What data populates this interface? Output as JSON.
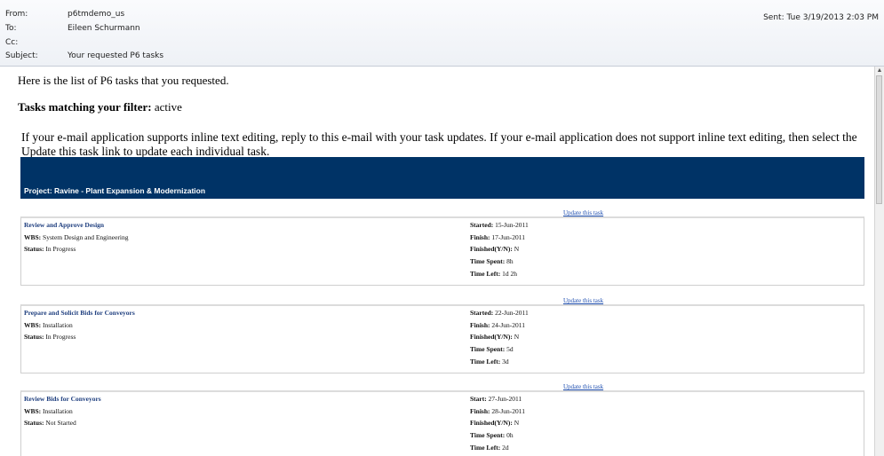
{
  "email": {
    "from_label": "From:",
    "from": "p6tmdemo_us",
    "to_label": "To:",
    "to": "Eileen Schurmann",
    "cc_label": "Cc:",
    "cc": "",
    "subject_label": "Subject:",
    "subject": "Your requested P6 tasks",
    "sent_label": "Sent:",
    "sent": "Tue 3/19/2013 2:03 PM"
  },
  "body": {
    "intro": "Here is the list of P6 tasks that you requested.",
    "filter_label": "Tasks matching your filter:",
    "filter_value": "active",
    "instructions": "If your e-mail application supports inline text editing, reply to this e-mail with your task updates. If your e-mail application does not support inline text editing, then select the Update this task link to update each individual task.",
    "project": "Project: Ravine - Plant Expansion & Modernization",
    "update_link": "Update this task",
    "labels": {
      "wbs": "WBS:",
      "status": "Status:",
      "finish": "Finish:",
      "finished": "Finished(Y/N):",
      "time_spent": "Time Spent:",
      "time_left": "Time Left:"
    },
    "tasks": [
      {
        "name": "Review and Approve Design",
        "wbs": "System Design and Engineering",
        "status": "In Progress",
        "start_label": "Started:",
        "start": "15-Jun-2011",
        "finish": "17-Jun-2011",
        "finished": "N",
        "time_spent": "8h",
        "time_left": "1d 2h"
      },
      {
        "name": "Prepare and Solicit Bids for Conveyors",
        "wbs": "Installation",
        "status": "In Progress",
        "start_label": "Started:",
        "start": "22-Jun-2011",
        "finish": "24-Jun-2011",
        "finished": "N",
        "time_spent": "5d",
        "time_left": "3d"
      },
      {
        "name": "Review Bids for Conveyors",
        "wbs": "Installation",
        "status": "Not Started",
        "start_label": "Start:",
        "start": "27-Jun-2011",
        "finish": "28-Jun-2011",
        "finished": "N",
        "time_spent": "0h",
        "time_left": "2d"
      }
    ]
  },
  "icons": {
    "scroll_up": "scroll-up-arrow-icon"
  }
}
